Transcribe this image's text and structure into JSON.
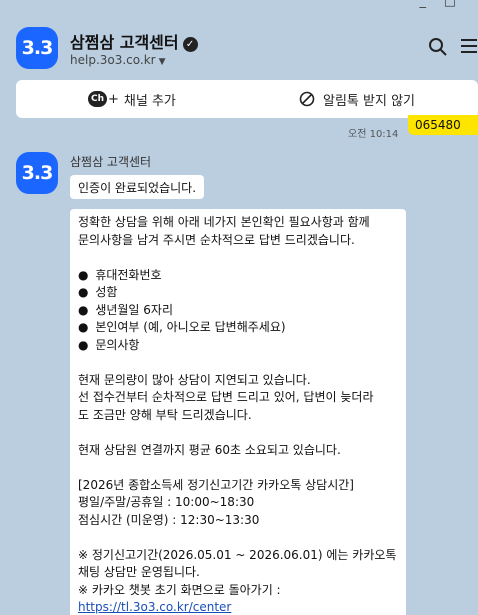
{
  "channel": {
    "name": "삼쩜삼 고객센터",
    "url": "help.3o3.co.kr",
    "logo_text": "3.3",
    "verified_icon": "check-badge-icon",
    "brand_color": "#1a66ff"
  },
  "actions": {
    "add_label": "채널 추가",
    "add_badge": "Ch",
    "add_plus": "+",
    "block_label": "알림톡 받지 않기"
  },
  "messages": {
    "outgoing": {
      "time": "오전 10:14",
      "text": "065480",
      "color": "#fee500"
    },
    "incoming": {
      "sender": "삼쩜삼 고객센터",
      "bubble1": "인증이 완료되었습니다.",
      "body": {
        "intro_1": "정확한 상담을 위해 아래 네가지 본인확인 필요사항과 함께",
        "intro_2": "문의사항을 남겨 주시면 순차적으로 답변 드리겠습니다.",
        "bullet_glyph": "●",
        "items": [
          "휴대전화번호",
          "성함",
          "생년월일 6자리",
          "본인여부 (예, 아니오로 답변해주세요)",
          "문의사항"
        ],
        "notice_1": "현재 문의량이 많아 상담이 지연되고 있습니다.",
        "notice_2": "선 접수건부터 순차적으로 답변 드리고 있어, 답변이 늦더라",
        "notice_3": "도 조금만 양해 부탁 드리겠습니다.",
        "wait": "현재 상담원 연결까지 평균 60초 소요되고 있습니다.",
        "hours_title": "[2026년 종합소득세 정기신고기간 카카오톡 상담시간]",
        "hours_weekday": "평일/주말/공휴일 : 10:00~18:30",
        "hours_lunch": "점심시간 (미운영) : 12:30~13:30",
        "period_1": "※ 정기신고기간(2026.05.01 ~ 2026.06.01) 에는 카카오톡",
        "period_2": "채팅 상담만 운영됩니다.",
        "back": "※ 카카오 챗봇 초기 화면으로 돌아가기 :",
        "link": "https://tl.3o3.co.kr/center"
      }
    }
  },
  "window": {
    "minimize": "_",
    "maximize": "□"
  }
}
